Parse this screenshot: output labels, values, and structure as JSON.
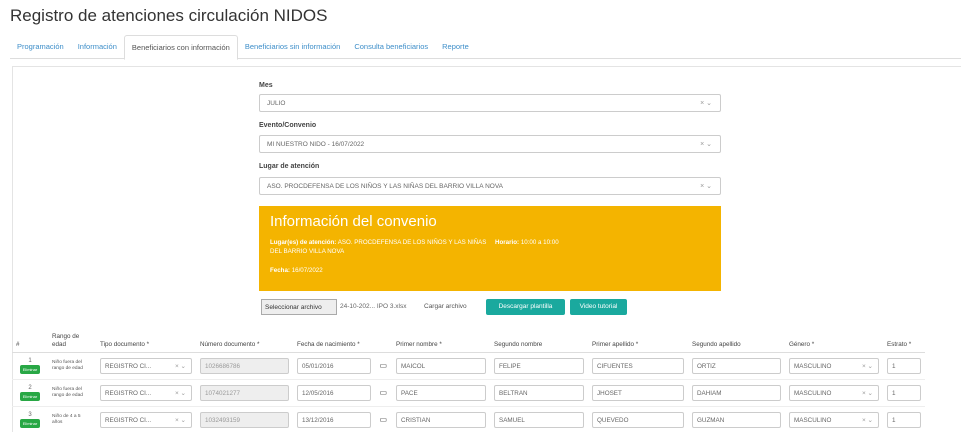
{
  "title": "Registro de atenciones circulación NIDOS",
  "tabs": [
    "Programación",
    "Información",
    "Beneficiarios con información",
    "Beneficiarios sin información",
    "Consulta beneficiarios",
    "Reporte"
  ],
  "form": {
    "mes_label": "Mes",
    "mes_value": "JULIO",
    "evento_label": "Evento/Convenio",
    "evento_value": "MI NUESTRO NIDO - 16/07/2022",
    "lugar_label": "Lugar de atención",
    "lugar_value": "ASO. PROCDEFENSA DE LOS NIÑOS Y LAS NIÑAS DEL BARRIO VILLA NOVA",
    "clear_icon": "×",
    "dropdown_icon": "⌄"
  },
  "convenio": {
    "title": "Información del convenio",
    "lugar_label": "Lugar(es) de atención:",
    "lugar_value": "ASO. PROCDEFENSA DE LOS NIÑOS Y LAS NIÑAS DEL BARRIO VILLA NOVA",
    "horario_label": "Horario:",
    "horario_value": "10:00 a 10:00",
    "fecha_label": "Fecha:",
    "fecha_value": "16/07/2022",
    "bg_color": "#f4b400"
  },
  "upload": {
    "select_label": "Seleccionar archivo",
    "file_name": "24-10-202... IPO 3.xlsx",
    "load_label": "Cargar archivo",
    "download_label": "Descargar plantilla",
    "video_label": "Video tutorial",
    "teal_color": "#1aa99e"
  },
  "table": {
    "headers": [
      "#",
      "Rango de edad",
      "Tipo documento *",
      "Número documento *",
      "Fecha de nacimiento *",
      "Primer nombre *",
      "Segundo nombre",
      "Primer apellido *",
      "Segundo apellido",
      "Género *",
      "Estrato *"
    ],
    "rows": [
      {
        "num": "1",
        "badge": "Eliminar",
        "rango": "Niño fuera del rango de edad",
        "tipo": "REGISTRO CI...",
        "documento": "1026686786",
        "fecha": "05/01/2016",
        "primer_nombre": "MAICOL",
        "segundo_nombre": "FELIPE",
        "primer_apellido": "CIFUENTES",
        "segundo_apellido": "ORTIZ",
        "genero": "MASCULINO",
        "estrato": "1"
      },
      {
        "num": "2",
        "badge": "Eliminar",
        "rango": "Niño fuera del rango de edad",
        "tipo": "REGISTRO CI...",
        "documento": "1074021277",
        "fecha": "12/05/2016",
        "primer_nombre": "PACE",
        "segundo_nombre": "BELTRAN",
        "primer_apellido": "JHOSET",
        "segundo_apellido": "DAHIAM",
        "genero": "MASCULINO",
        "estrato": "1"
      },
      {
        "num": "3",
        "badge": "Eliminar",
        "rango": "Niño de 4 a 5 años",
        "tipo": "REGISTRO CI...",
        "documento": "1032493159",
        "fecha": "13/12/2016",
        "primer_nombre": "CRISTIAN",
        "segundo_nombre": "SAMUEL",
        "primer_apellido": "QUEVEDO",
        "segundo_apellido": "GUZMAN",
        "genero": "MASCULINO",
        "estrato": "1"
      }
    ],
    "badge_color": "#28a745",
    "calendar_icon": "▭"
  }
}
